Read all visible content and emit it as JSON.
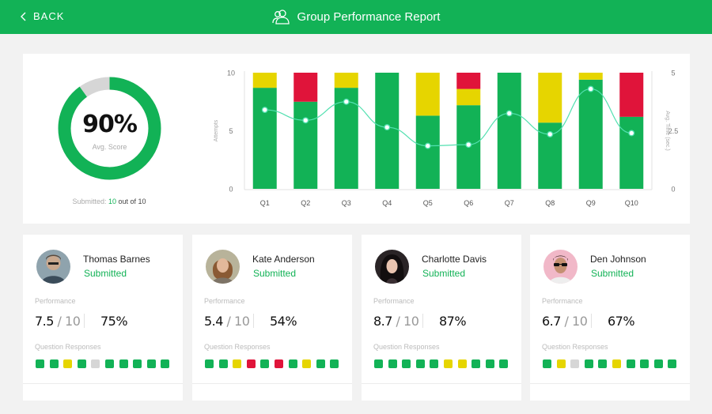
{
  "header": {
    "back_label": "BACK",
    "title": "Group Performance Report"
  },
  "colors": {
    "green": "#12b256",
    "yellow": "#e6d500",
    "red": "#e0143a",
    "gray": "#d6d6d6",
    "line": "#52e0b0"
  },
  "summary": {
    "avg_score_value": "90%",
    "avg_score_fraction": 0.9,
    "avg_score_label": "Avg. Score",
    "submitted_prefix": "Submitted:",
    "submitted_count": "10",
    "submitted_suffix": "out of 10"
  },
  "chart_data": {
    "type": "bar",
    "categories": [
      "Q1",
      "Q2",
      "Q3",
      "Q4",
      "Q5",
      "Q6",
      "Q7",
      "Q8",
      "Q9",
      "Q10"
    ],
    "series": [
      {
        "color": "#12b256",
        "values": [
          8.7,
          7.5,
          8.7,
          10,
          6.3,
          7.2,
          10,
          5.7,
          9.4,
          6.2
        ]
      },
      {
        "color": "#e6d500",
        "values": [
          1.3,
          0,
          1.3,
          0,
          3.7,
          1.4,
          0,
          4.3,
          0.6,
          0
        ]
      },
      {
        "color": "#e0143a",
        "values": [
          0,
          2.5,
          0,
          0,
          0,
          1.4,
          0,
          0,
          0,
          3.8
        ]
      }
    ],
    "line": {
      "axis": "right",
      "color": "#52e0b0",
      "values": [
        3.4,
        2.95,
        3.75,
        2.65,
        1.85,
        1.9,
        3.25,
        2.35,
        4.3,
        2.4
      ]
    },
    "ylabel": "Attempts",
    "ylabel_right": "Avg. Time (sec.)",
    "ylim": [
      0,
      10
    ],
    "ylim_right": [
      0,
      5
    ],
    "yticks": [
      "0",
      "5",
      "10"
    ],
    "yticks_right": [
      "0",
      "2.5",
      "5"
    ]
  },
  "cards_labels": {
    "performance": "Performance",
    "responses": "Question Responses"
  },
  "students": [
    {
      "name": "Thomas Barnes",
      "status": "Submitted",
      "score": "7.5",
      "out_of": "/ 10",
      "percent": "75%",
      "responses": [
        "green",
        "green",
        "yellow",
        "green",
        "gray",
        "green",
        "green",
        "green",
        "green",
        "green"
      ]
    },
    {
      "name": "Kate Anderson",
      "status": "Submitted",
      "score": "5.4",
      "out_of": "/ 10",
      "percent": "54%",
      "responses": [
        "green",
        "green",
        "yellow",
        "red",
        "green",
        "red",
        "green",
        "yellow",
        "green",
        "green"
      ]
    },
    {
      "name": "Charlotte Davis",
      "status": "Submitted",
      "score": "8.7",
      "out_of": "/ 10",
      "percent": "87%",
      "responses": [
        "green",
        "green",
        "green",
        "green",
        "green",
        "yellow",
        "yellow",
        "green",
        "green",
        "green"
      ]
    },
    {
      "name": "Den Johnson",
      "status": "Submitted",
      "score": "6.7",
      "out_of": "/ 10",
      "percent": "67%",
      "responses": [
        "green",
        "yellow",
        "gray",
        "green",
        "green",
        "yellow",
        "green",
        "green",
        "green",
        "green"
      ]
    }
  ]
}
